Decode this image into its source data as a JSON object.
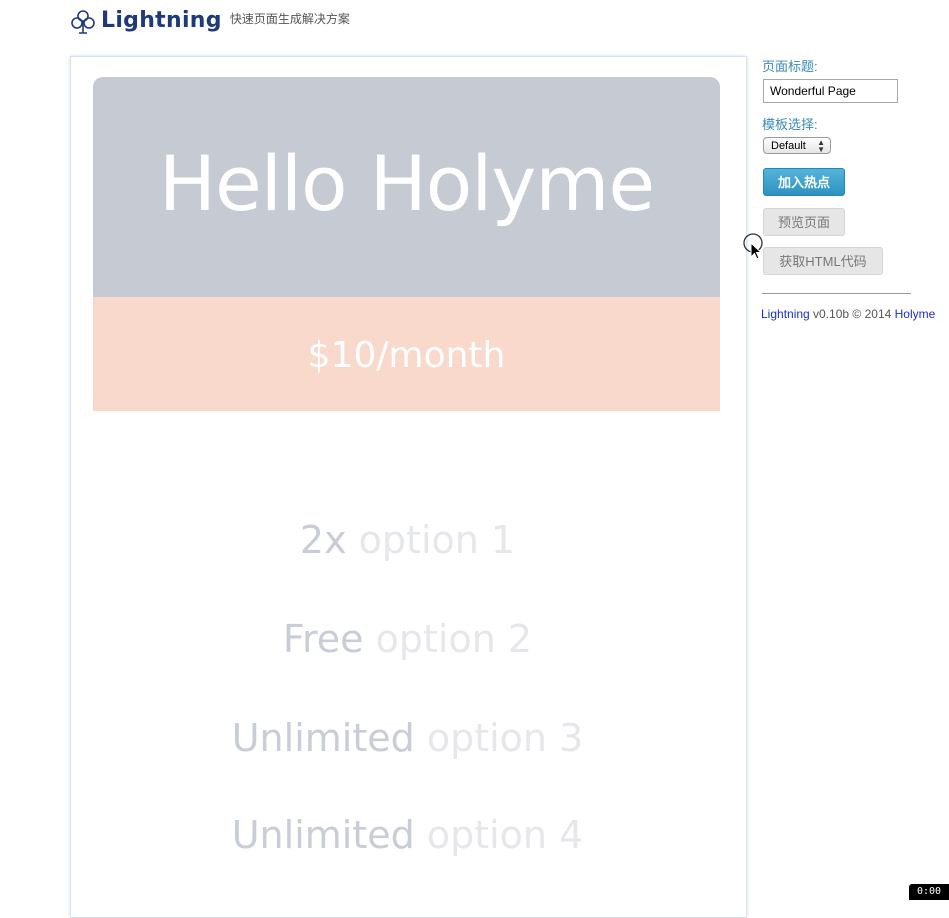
{
  "header": {
    "logo_icon": "club-icon",
    "app_name": "Lightning",
    "tagline": "快速页面生成解决方案"
  },
  "canvas": {
    "hero_title": "Hello Holyme",
    "price": "$10/month",
    "options": [
      {
        "strong": "2x",
        "light": "option 1"
      },
      {
        "strong": "Free",
        "light": "option 2"
      },
      {
        "strong": "Unlimited",
        "light": "option 3"
      },
      {
        "strong": "Unlimited",
        "light": "option 4"
      }
    ],
    "colors": {
      "hero_bg": "#c6cad3",
      "price_bg": "#fad9cd"
    }
  },
  "sidebar": {
    "page_title_label": "页面标题:",
    "page_title_value": "Wonderful Page",
    "template_label": "模板选择:",
    "template_selected": "Default",
    "add_hotspot_button": "加入热点",
    "preview_button": "预览页面",
    "get_html_button": "获取HTML代码",
    "accent_color": "#2d93c2"
  },
  "footer": {
    "product": "Lightning",
    "version_text": " v0.10b © 2014 ",
    "author": "Holyme"
  },
  "recorder": {
    "timer": "0:00"
  }
}
